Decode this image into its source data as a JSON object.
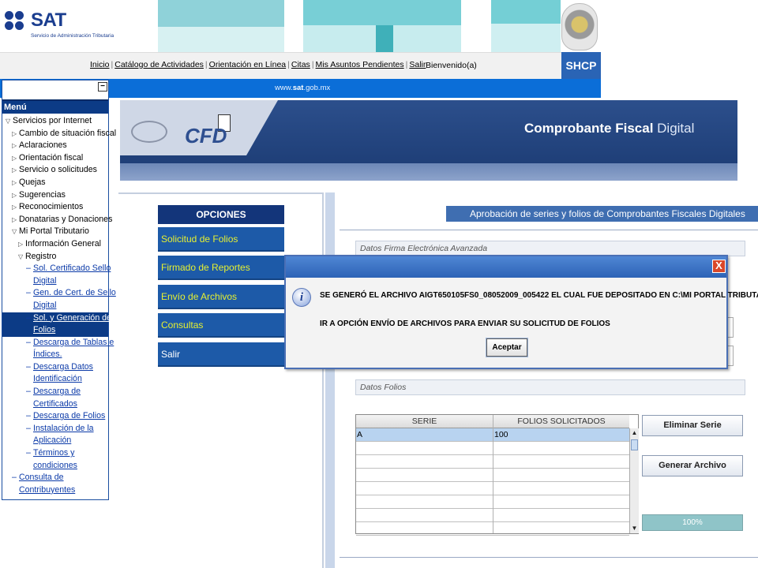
{
  "header": {
    "logo_text": "SAT",
    "logo_subtitle": "Servicio de Administración Tributaria",
    "nav_links": [
      "Inicio",
      "Catálogo de Actividades",
      "Orientación en Línea",
      "Citas",
      "Mis Asuntos Pendientes",
      "Salir"
    ],
    "welcome": "Bienvenido(a)",
    "shcp": "SHCP",
    "url_prefix": "www.",
    "url_bold": "sat",
    "url_suffix": ".gob.mx"
  },
  "menu": {
    "collapse": "−",
    "title": "Menú",
    "items": [
      {
        "label": "Servicios por Internet",
        "level": 0,
        "icon": "expanded-triangle-icon",
        "link": false
      },
      {
        "label": "Cambio de situación fiscal",
        "level": 1,
        "icon": "collapsed-triangle-icon",
        "link": false
      },
      {
        "label": "Aclaraciones",
        "level": 1,
        "icon": "collapsed-triangle-icon",
        "link": false
      },
      {
        "label": "Orientación fiscal",
        "level": 1,
        "icon": "collapsed-triangle-icon",
        "link": false
      },
      {
        "label": "Servicio o solicitudes",
        "level": 1,
        "icon": "collapsed-triangle-icon",
        "link": false
      },
      {
        "label": "Quejas",
        "level": 1,
        "icon": "collapsed-triangle-icon",
        "link": false
      },
      {
        "label": "Sugerencias",
        "level": 1,
        "icon": "collapsed-triangle-icon",
        "link": false
      },
      {
        "label": "Reconocimientos",
        "level": 1,
        "icon": "collapsed-triangle-icon",
        "link": false
      },
      {
        "label": "Donatarias y Donaciones",
        "level": 1,
        "icon": "collapsed-triangle-icon",
        "link": false
      },
      {
        "label": "Mi Portal Tributario",
        "level": 1,
        "icon": "expanded-triangle-icon",
        "link": false
      },
      {
        "label": "Información General",
        "level": 2,
        "icon": "collapsed-triangle-icon",
        "link": false
      },
      {
        "label": "Registro",
        "level": 2,
        "icon": "expanded-triangle-icon",
        "link": false
      },
      {
        "label": "Sol. Certificado Sello",
        "level": 3,
        "icon": "dash-icon",
        "link": true
      },
      {
        "label": "Digital",
        "level": 3,
        "icon": "",
        "link": true
      },
      {
        "label": "Gen. de Cert. de Sello",
        "level": 3,
        "icon": "dash-icon",
        "link": true
      },
      {
        "label": "Digital",
        "level": 3,
        "icon": "",
        "link": true
      },
      {
        "label": "Sol. y Generación de",
        "level": 3,
        "icon": "dash-icon",
        "link": true,
        "selected": true
      },
      {
        "label": "Folios",
        "level": 3,
        "icon": "",
        "link": true,
        "selected": true
      },
      {
        "label": "Descarga de Tablas e",
        "level": 3,
        "icon": "dash-icon",
        "link": true
      },
      {
        "label": "Índices.",
        "level": 3,
        "icon": "",
        "link": true
      },
      {
        "label": "Descarga Datos",
        "level": 3,
        "icon": "dash-icon",
        "link": true
      },
      {
        "label": "Identificación",
        "level": 3,
        "icon": "",
        "link": true
      },
      {
        "label": "Descarga de",
        "level": 3,
        "icon": "dash-icon",
        "link": true
      },
      {
        "label": "Certificados",
        "level": 3,
        "icon": "",
        "link": true
      },
      {
        "label": "Descarga de Folios",
        "level": 3,
        "icon": "dash-icon",
        "link": true
      },
      {
        "label": "Instalación de la",
        "level": 3,
        "icon": "dash-icon",
        "link": true
      },
      {
        "label": "Aplicación",
        "level": 3,
        "icon": "",
        "link": true
      },
      {
        "label": "Términos y",
        "level": 3,
        "icon": "dash-icon",
        "link": true
      },
      {
        "label": "condiciones",
        "level": 3,
        "icon": "",
        "link": true
      },
      {
        "label": "Consulta de",
        "level": 1,
        "icon": "dash-icon",
        "link": true
      },
      {
        "label": "Contribuyentes",
        "level": 1,
        "icon": "",
        "link": true
      }
    ]
  },
  "cfd": {
    "logo_text": "CFD",
    "title_bold": "Comprobante Fiscal ",
    "title_light": "Digital"
  },
  "options": {
    "heading": "OPCIONES",
    "items": [
      "Solicitud de Folios",
      "Firmado de Reportes",
      "Envío de Archivos",
      "Consultas",
      "Salir"
    ]
  },
  "content": {
    "title": "Aprobación de series y folios de Comprobantes Fiscales Digitales",
    "section_firma": "Datos Firma Electrónica Avanzada",
    "section_folios": "Datos Folios",
    "table": {
      "columns": [
        "SERIE",
        "FOLIOS SOLICITADOS"
      ],
      "rows": [
        [
          "A",
          "100"
        ],
        [
          "",
          ""
        ],
        [
          "",
          ""
        ],
        [
          "",
          ""
        ],
        [
          "",
          ""
        ],
        [
          "",
          ""
        ],
        [
          "",
          ""
        ],
        [
          "",
          ""
        ]
      ]
    },
    "buttons": {
      "eliminar": "Eliminar Serie",
      "generar": "Generar Archivo"
    },
    "progress_label": "100%",
    "progress_value": 1.0
  },
  "dialog": {
    "close": "X",
    "icon": "i",
    "message_line1": "SE GENERÓ EL ARCHIVO AIGT650105FS0_08052009_005422 EL CUAL FUE DEPOSITADO EN C:\\MI PORTAL TRIBUTARIO",
    "message_line2": "IR A OPCIÓN ENVÍO DE ARCHIVOS PARA ENVIAR SU SOLICITUD DE FOLIOS",
    "ok_label": "Aceptar"
  },
  "colors": {
    "sat_blue": "#1a3d8f",
    "menu_selected": "#0c3b86",
    "option_bg": "#1d5aa8",
    "option_text": "#e6f030",
    "dialog_title": "#2d63b6",
    "progress": "#8fc4c8"
  }
}
